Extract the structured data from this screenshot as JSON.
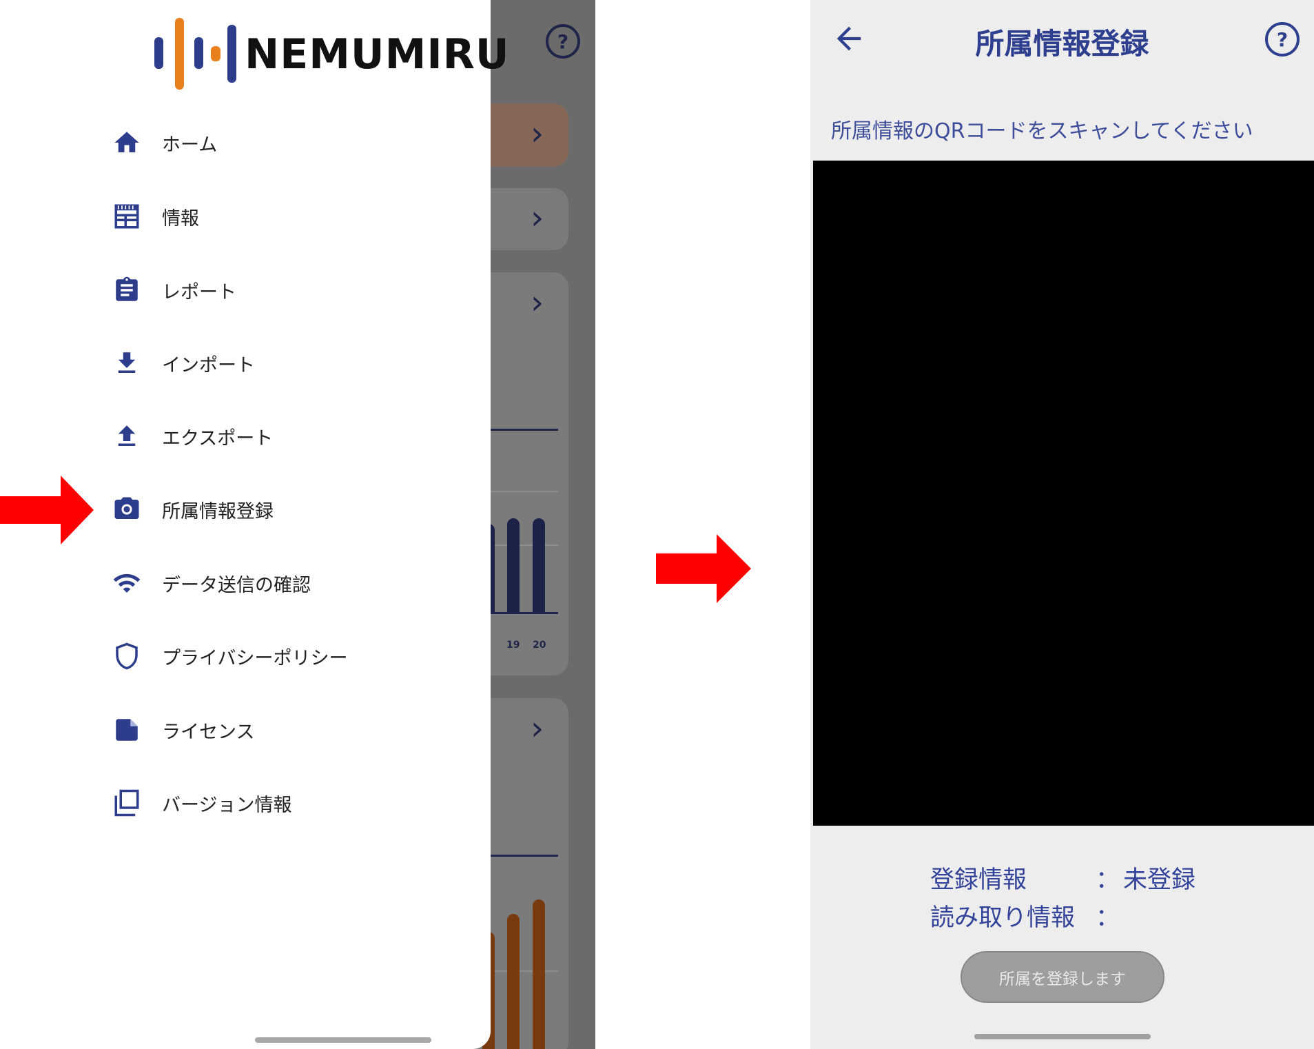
{
  "left_screen": {
    "logo_text": "NEMUMIRU",
    "menu_items": [
      {
        "label": "ホーム",
        "icon": "home-icon"
      },
      {
        "label": "情報",
        "icon": "newspaper-icon"
      },
      {
        "label": "レポート",
        "icon": "clipboard-icon"
      },
      {
        "label": "インポート",
        "icon": "download-icon"
      },
      {
        "label": "エクスポート",
        "icon": "upload-icon"
      },
      {
        "label": "所属情報登録",
        "icon": "camera-icon"
      },
      {
        "label": "データ送信の確認",
        "icon": "wifi-icon"
      },
      {
        "label": "プライバシーポリシー",
        "icon": "shield-icon"
      },
      {
        "label": "ライセンス",
        "icon": "document-icon"
      },
      {
        "label": "バージョン情報",
        "icon": "copy-icon"
      }
    ],
    "background_chart_ticks": [
      "19",
      "20"
    ]
  },
  "right_screen": {
    "title": "所属情報登録",
    "instruction": "所属情報のQRコードをスキャンしてください",
    "registration_info_label": "登録情報",
    "registration_info_value": "未登録",
    "read_info_label": "読み取り情報",
    "read_info_value": "",
    "separator": "：",
    "register_button_label": "所属を登録します"
  },
  "colors": {
    "accent": "#2f3f8f",
    "icon": "#2e3c8c",
    "highlight_arrow": "#ff0000",
    "logo_orange": "#e8801e"
  }
}
